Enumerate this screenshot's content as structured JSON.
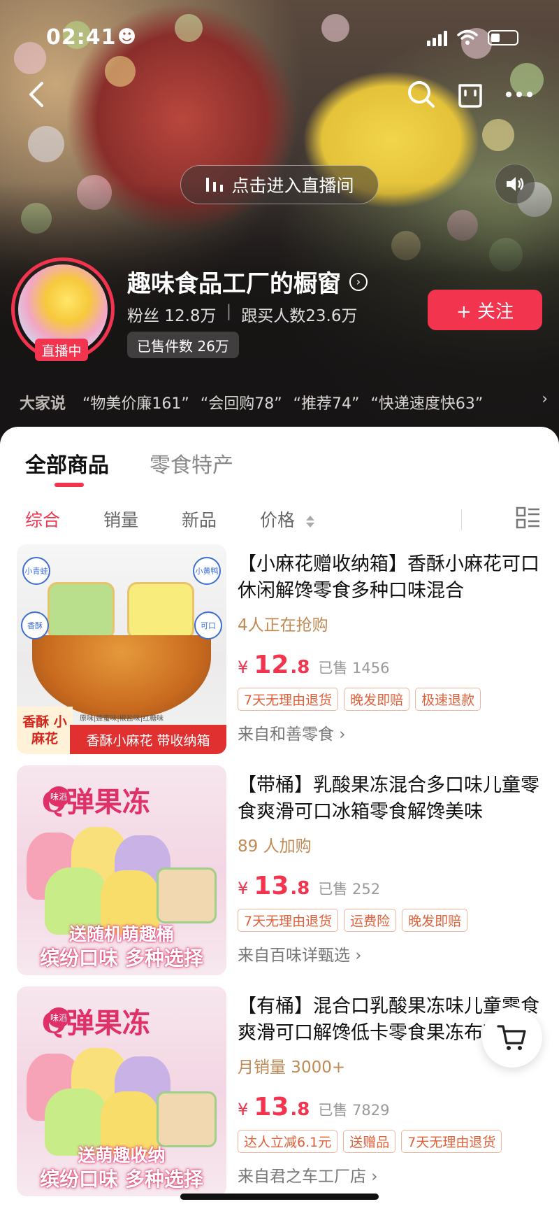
{
  "status": {
    "time": "02:41"
  },
  "live": {
    "enter_label": "点击进入直播间",
    "badge": "直播中"
  },
  "shop": {
    "name": "趣味食品工厂的橱窗",
    "fans": "粉丝 12.8万",
    "buyers": "跟买人数23.6万",
    "sold": "已售件数 26万",
    "follow_label": "+ 关注"
  },
  "reviews": {
    "lead": "大家说",
    "items": [
      "物美价廉161",
      "会回购78",
      "推荐74",
      "快递速度快63"
    ]
  },
  "tabs": [
    "全部商品",
    "零食特产"
  ],
  "filters": [
    "综合",
    "销量",
    "新品",
    "价格"
  ],
  "products": [
    {
      "title": "【小麻花赠收纳箱】香酥小麻花可口休闲解馋零食多种口味混合",
      "sub": "4人正在抢购",
      "price_int": "12",
      "price_dec": ".8",
      "sold": "已售 1456",
      "tags": [
        "7天无理由退货",
        "晚发即赔",
        "极速退款"
      ],
      "shop": "来自和善零食 ›",
      "thumb": {
        "banner": "香酥小麻花 带收纳箱",
        "corner": "香酥 小麻花",
        "bubbles": [
          "小青蛙",
          "小黄鸭",
          "香酥",
          "可口"
        ],
        "flavors": "原味|蜂蜜味|椒盐味|红糖味"
      }
    },
    {
      "title": "【带桶】乳酸果冻混合多口味儿童零食爽滑可口冰箱零食解馋美味",
      "sub": "89 人加购",
      "price_int": "13",
      "price_dec": ".8",
      "sold": "已售 252",
      "tags": [
        "7天无理由退货",
        "运费险",
        "晚发即赔"
      ],
      "shop": "来自百味详甄选 ›",
      "thumb": {
        "head": "Q弹果冻",
        "mini": "味滔",
        "strip1": "送随机萌趣桶",
        "strip2": "缤纷口味 多种选择"
      }
    },
    {
      "title": "【有桶】混合口乳酸果冻味儿童零食爽滑可口解馋低卡零食果冻布丁",
      "sub": "月销量 3000+",
      "price_int": "13",
      "price_dec": ".8",
      "sold": "已售 7829",
      "tags": [
        "达人立减6.1元",
        "送赠品",
        "7天无理由退货"
      ],
      "shop": "来自君之车工厂店 ›",
      "thumb": {
        "head": "Q弹果冻",
        "mini": "味滔",
        "strip1": "送萌趣收纳",
        "strip2": "缤纷口味 多种选择"
      }
    }
  ],
  "colors": {
    "accent": "#f2344f",
    "price": "#f2344f",
    "tag": "#e0603a"
  }
}
